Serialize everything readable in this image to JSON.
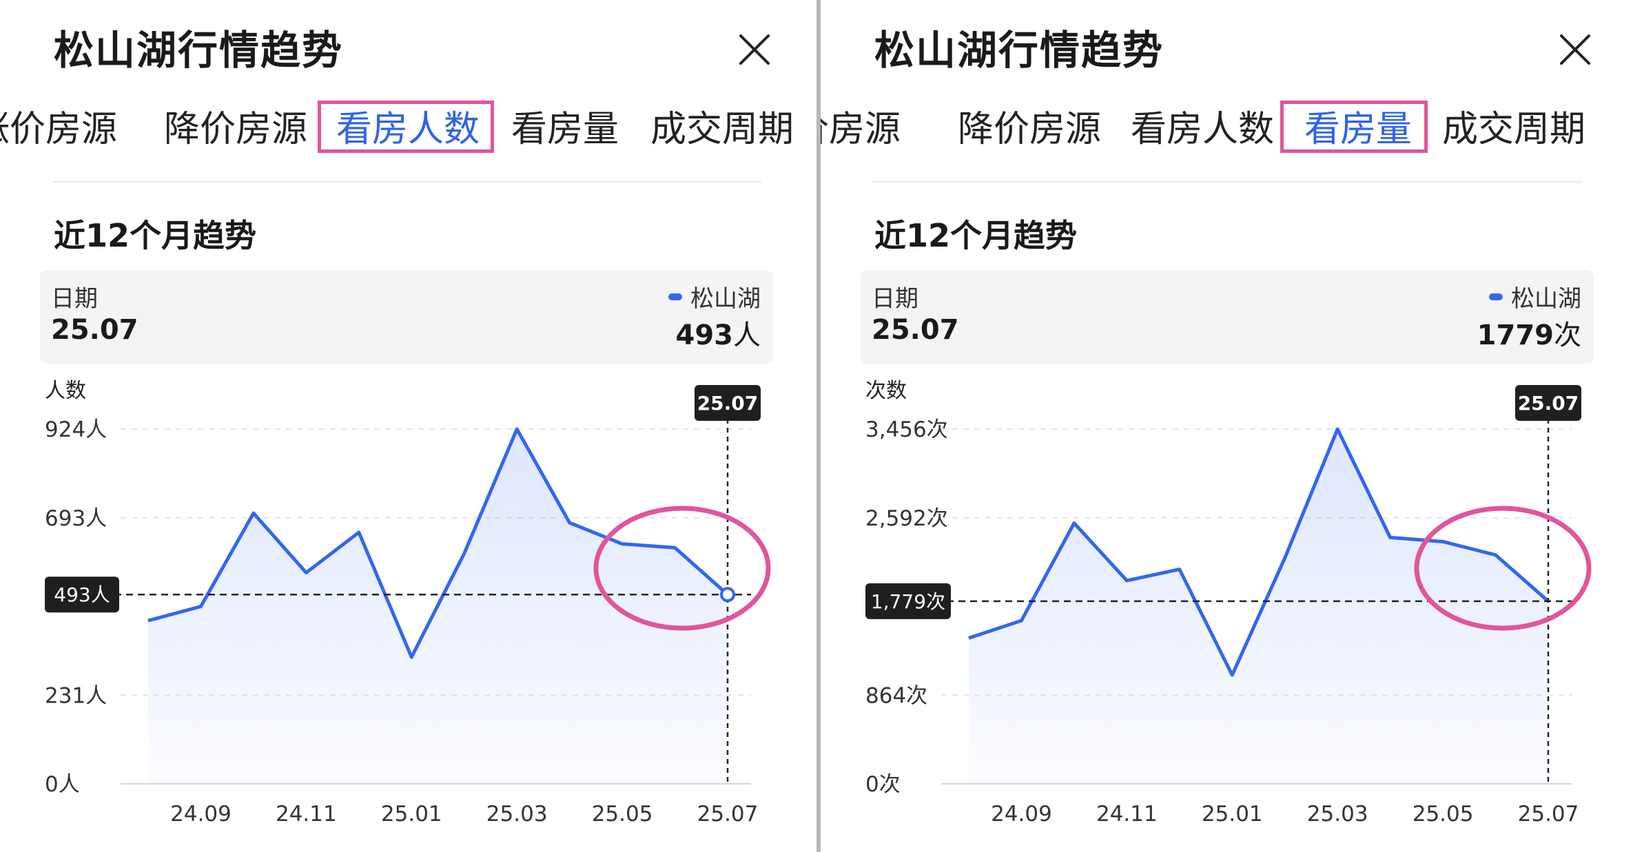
{
  "panels": [
    {
      "title": "松山湖行情趋势",
      "tabs": [
        "涨价房源",
        "降价房源",
        "看房人数",
        "看房量",
        "成交周期"
      ],
      "active_tab": "看房人数",
      "section_title": "近12个月趋势",
      "info": {
        "date_label": "日期",
        "date_value": "25.07",
        "legend": "松山湖",
        "metric_value": "493",
        "metric_unit": "人"
      },
      "chart_data": {
        "type": "area",
        "y_unit_label": "人数",
        "y_ticks": [
          "924人",
          "693人",
          "231人",
          "0人"
        ],
        "y_tick_values": [
          924,
          693,
          231,
          0
        ],
        "x_ticks": [
          "24.09",
          "24.11",
          "25.01",
          "25.03",
          "25.05",
          "25.07"
        ],
        "x": [
          "24.08",
          "24.09",
          "24.10",
          "24.11",
          "24.12",
          "25.01",
          "25.02",
          "25.03",
          "25.04",
          "25.05",
          "25.06",
          "25.07"
        ],
        "values": [
          425,
          462,
          705,
          550,
          655,
          330,
          600,
          924,
          680,
          625,
          615,
          493
        ],
        "ylim": [
          0,
          924
        ],
        "crosshair_x": "25.07",
        "crosshair_y_label": "493人",
        "tooltip": "25.07",
        "grid": true,
        "series_color": "#3366f0"
      }
    },
    {
      "title": "松山湖行情趋势",
      "tabs": [
        "涨价房源",
        "降价房源",
        "看房人数",
        "看房量",
        "成交周期"
      ],
      "active_tab": "看房量",
      "section_title": "近12个月趋势",
      "info": {
        "date_label": "日期",
        "date_value": "25.07",
        "legend": "松山湖",
        "metric_value": "1779",
        "metric_unit": "次"
      },
      "chart_data": {
        "type": "area",
        "y_unit_label": "次数",
        "y_ticks": [
          "3,456次",
          "2,592次",
          "864次",
          "0次"
        ],
        "y_tick_values": [
          3456,
          2592,
          864,
          0
        ],
        "x_ticks": [
          "24.09",
          "24.11",
          "25.01",
          "25.03",
          "25.05",
          "25.07"
        ],
        "x": [
          "24.08",
          "24.09",
          "24.10",
          "24.11",
          "24.12",
          "25.01",
          "25.02",
          "25.03",
          "25.04",
          "25.05",
          "25.06",
          "25.07"
        ],
        "values": [
          1420,
          1590,
          2540,
          1980,
          2090,
          1060,
          2200,
          3456,
          2400,
          2360,
          2230,
          1779
        ],
        "ylim": [
          0,
          3456
        ],
        "crosshair_x": "25.07",
        "crosshair_y_label": "1,779次",
        "tooltip": "25.07",
        "grid": true,
        "series_color": "#3366f0"
      }
    }
  ]
}
